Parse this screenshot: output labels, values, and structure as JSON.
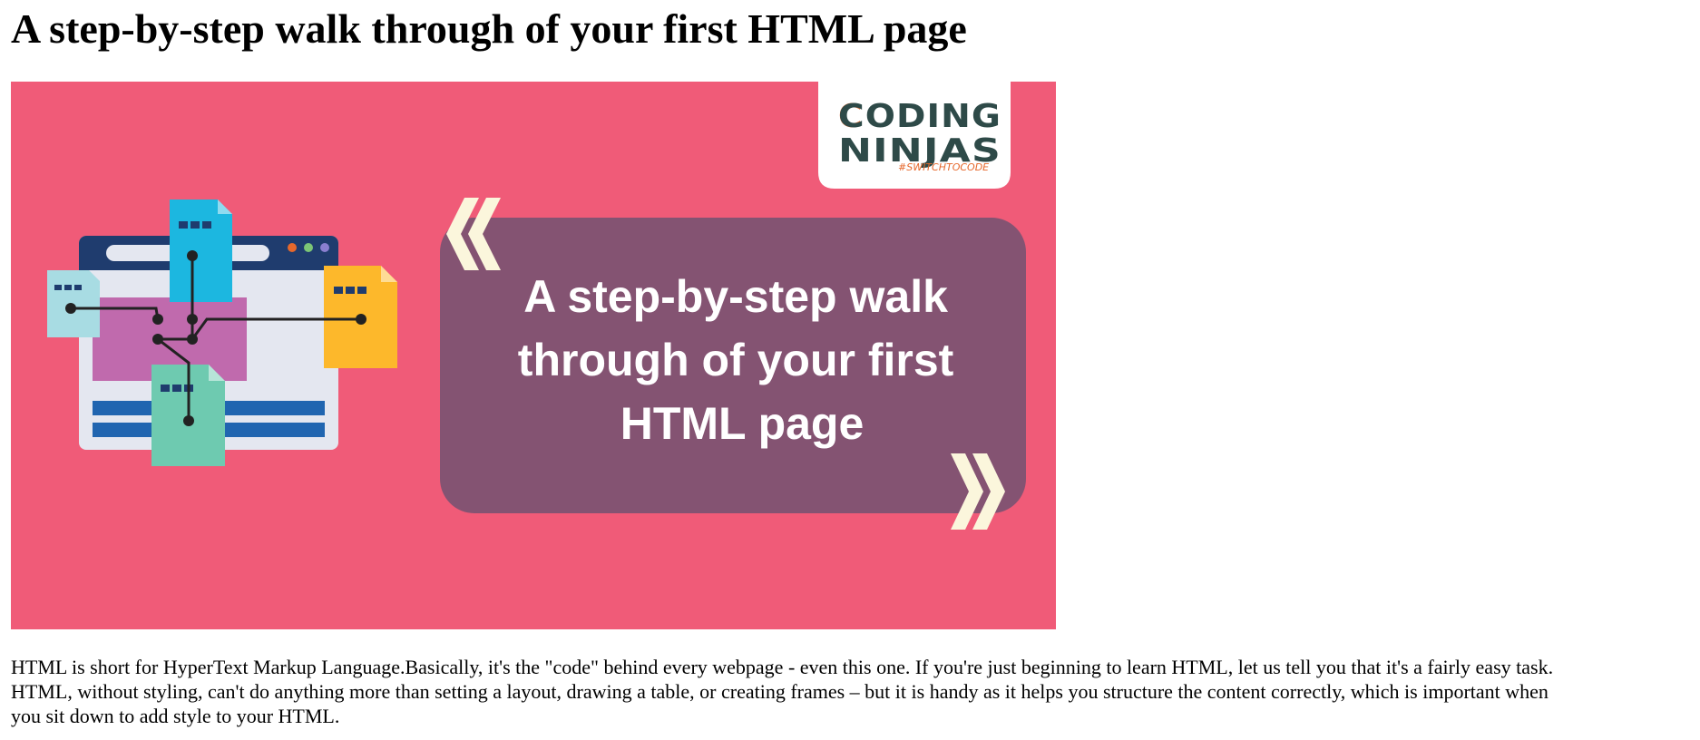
{
  "page": {
    "title": "A step-by-step walk through of your first HTML page"
  },
  "banner": {
    "background_color": "#f05b78",
    "panel_color": "#845372",
    "headline_lines": [
      "A step-by-step walk",
      "through of your first",
      "HTML page"
    ],
    "logo": {
      "line1": "CODING",
      "line2": "NINJAS",
      "tagline": "#SWITCHTOCODE"
    },
    "illustration": "browser-window-with-linked-html-documents"
  },
  "intro": {
    "text": "HTML is short for HyperText Markup Language.Basically, it's the \"code\" behind every webpage - even this one. If you're just beginning to learn HTML, let us tell you that it's a fairly easy task.\nHTML, without styling, can't do anything more than setting a layout, drawing a table, or creating frames – but it is handy as it helps you structure the content correctly, which is important when\nyou sit down to add style to your HTML."
  }
}
